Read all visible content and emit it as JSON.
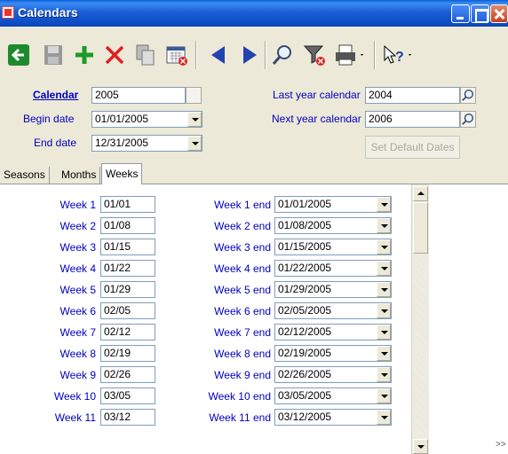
{
  "window": {
    "title": "Calendars"
  },
  "toolbar": {
    "icons": [
      "back-arrow-icon",
      "save-icon",
      "add-icon",
      "delete-icon",
      "copy-icon",
      "calendar-clear-icon",
      "previous-icon",
      "next-icon",
      "find-icon",
      "filter-icon",
      "print-icon",
      "help-icon"
    ]
  },
  "form": {
    "calendar_label": "Calendar",
    "calendar_value": "2005",
    "begin_label": "Begin date",
    "begin_value": "01/01/2005",
    "end_label": "End date",
    "end_value": "12/31/2005",
    "last_year_label": "Last year calendar",
    "last_year_value": "2004",
    "next_year_label": "Next year calendar",
    "next_year_value": "2006",
    "set_default_label": "Set Default Dates"
  },
  "tabs": [
    "Seasons",
    "Months",
    "Weeks"
  ],
  "weeks": [
    {
      "label": "Week 1",
      "start": "01/01",
      "end_label": "Week 1 end",
      "end": "01/01/2005"
    },
    {
      "label": "Week 2",
      "start": "01/08",
      "end_label": "Week 2 end",
      "end": "01/08/2005"
    },
    {
      "label": "Week 3",
      "start": "01/15",
      "end_label": "Week 3 end",
      "end": "01/15/2005"
    },
    {
      "label": "Week 4",
      "start": "01/22",
      "end_label": "Week 4 end",
      "end": "01/22/2005"
    },
    {
      "label": "Week 5",
      "start": "01/29",
      "end_label": "Week 5 end",
      "end": "01/29/2005"
    },
    {
      "label": "Week 6",
      "start": "02/05",
      "end_label": "Week 6 end",
      "end": "02/05/2005"
    },
    {
      "label": "Week 7",
      "start": "02/12",
      "end_label": "Week 7 end",
      "end": "02/12/2005"
    },
    {
      "label": "Week 8",
      "start": "02/19",
      "end_label": "Week 8 end",
      "end": "02/19/2005"
    },
    {
      "label": "Week 9",
      "start": "02/26",
      "end_label": "Week 9 end",
      "end": "02/26/2005"
    },
    {
      "label": "Week 10",
      "start": "03/05",
      "end_label": "Week 10 end",
      "end": "03/05/2005"
    },
    {
      "label": "Week 11",
      "start": "03/12",
      "end_label": "Week 11 end",
      "end": "03/12/2005"
    }
  ],
  "more_indicator": ">>"
}
